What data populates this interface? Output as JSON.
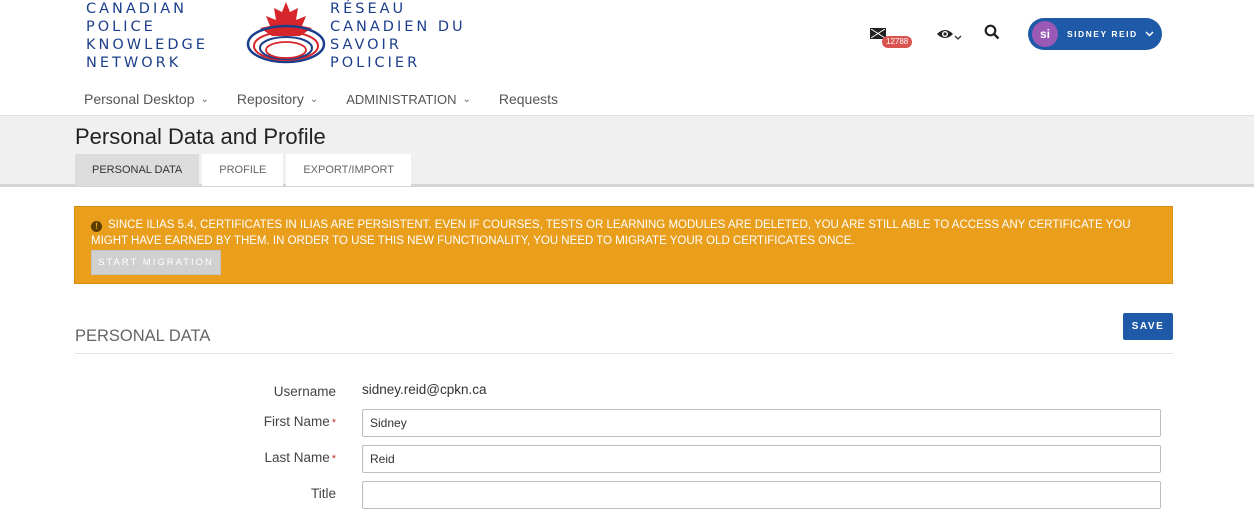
{
  "logo": {
    "en_lines": [
      "CANADIAN",
      "POLICE",
      "KNOWLEDGE",
      "NETWORK"
    ],
    "fr_lines": [
      "RÉSEAU",
      "CANADIEN DU",
      "SAVOIR",
      "POLICIER"
    ]
  },
  "header": {
    "mail_count": "12788",
    "user_initials": "si",
    "user_name": "SIDNEY REID"
  },
  "nav": {
    "items": [
      {
        "label": "Personal Desktop",
        "has_menu": true
      },
      {
        "label": "Repository",
        "has_menu": true
      },
      {
        "label": "ADMINISTRATION",
        "has_menu": true
      },
      {
        "label": "Requests",
        "has_menu": false
      }
    ]
  },
  "page": {
    "title": "Personal Data and Profile",
    "tabs": [
      {
        "label": "PERSONAL DATA",
        "active": true
      },
      {
        "label": "PROFILE",
        "active": false
      },
      {
        "label": "EXPORT/IMPORT",
        "active": false
      }
    ]
  },
  "alert": {
    "message": "SINCE ILIAS 5.4, CERTIFICATES IN ILIAS ARE PERSISTENT. EVEN IF COURSES, TESTS OR LEARNING MODULES ARE DELETED, YOU ARE STILL ABLE TO ACCESS ANY CERTIFICATE YOU MIGHT HAVE EARNED BY THEM. IN ORDER TO USE THIS NEW FUNCTIONALITY, YOU NEED TO MIGRATE YOUR OLD CERTIFICATES ONCE.",
    "button_label": "START MIGRATION"
  },
  "form": {
    "section_title": "PERSONAL DATA",
    "save_label": "SAVE",
    "username_label": "Username",
    "username_value": "sidney.reid@cpkn.ca",
    "first_name_label": "First Name",
    "first_name_value": "Sidney",
    "last_name_label": "Last Name",
    "last_name_value": "Reid",
    "title_label": "Title",
    "title_value": "",
    "required_marker": "*"
  },
  "colors": {
    "primary": "#1e5aa8",
    "alert": "#e99e1c",
    "badge": "#d9534f",
    "avatar": "#9b59b6"
  }
}
